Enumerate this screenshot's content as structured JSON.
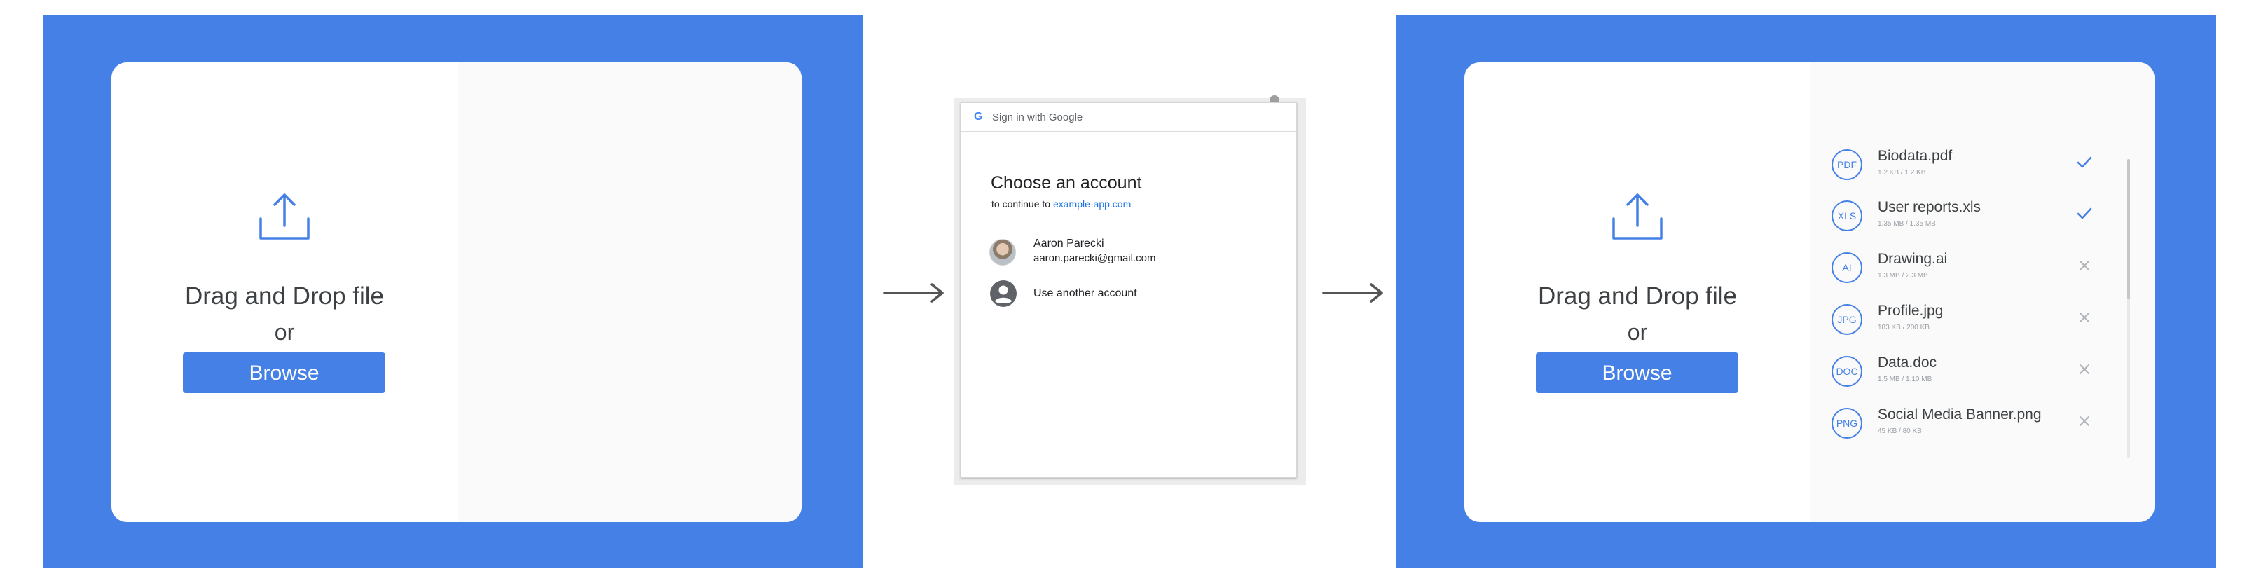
{
  "colors": {
    "accent": "#4580e6",
    "google_link": "#1a73e8"
  },
  "step1": {
    "drag_text": "Drag and Drop file",
    "or_text": "or",
    "browse_label": "Browse",
    "icon": "upload-icon"
  },
  "google_dialog": {
    "header_logo": "G",
    "header_text": "Sign in with Google",
    "title": "Choose an account",
    "subtitle_prefix": "to continue to ",
    "subtitle_link": "example-app.com",
    "account_name": "Aaron Parecki",
    "account_email": "aaron.parecki@gmail.com",
    "another_account": "Use another account"
  },
  "step3": {
    "drag_text": "Drag and Drop file",
    "or_text": "or",
    "browse_label": "Browse",
    "files": [
      {
        "badge": "PDF",
        "name": "Biodata.pdf",
        "size": "1.2 KB / 1.2 KB",
        "status": "check-icon"
      },
      {
        "badge": "XLS",
        "name": "User reports.xls",
        "size": "1.35 MB / 1.35 MB",
        "status": "check-icon"
      },
      {
        "badge": "AI",
        "name": "Drawing.ai",
        "size": "1.3 MB / 2.3 MB",
        "status": "close-icon"
      },
      {
        "badge": "JPG",
        "name": "Profile.jpg",
        "size": "183 KB / 200 KB",
        "status": "close-icon"
      },
      {
        "badge": "DOC",
        "name": "Data.doc",
        "size": "1.5 MB / 1.10 MB",
        "status": "close-icon"
      },
      {
        "badge": "PNG",
        "name": "Social Media Banner.png",
        "size": "45 KB / 80 KB",
        "status": "close-icon"
      }
    ]
  }
}
